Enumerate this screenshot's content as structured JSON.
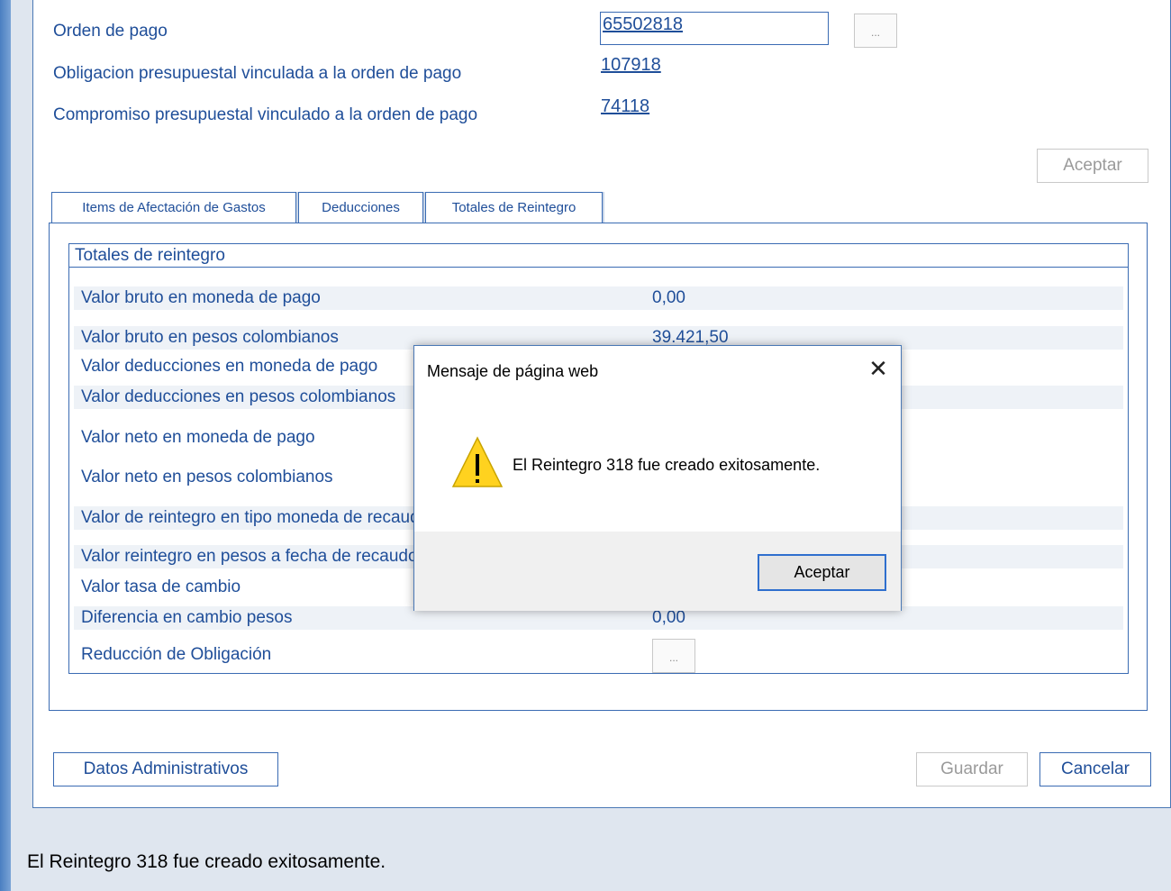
{
  "header": {
    "orden_label": "Orden de pago",
    "orden_value": "65502818",
    "obligacion_label": "Obligacion presupuestal vinculada a la orden de pago",
    "obligacion_value": "107918",
    "compromiso_label": "Compromiso presupuestal vinculado a la orden de pago",
    "compromiso_value": "74118",
    "ellipsis": "...",
    "aceptar": "Aceptar"
  },
  "tabs": [
    {
      "label": "Items de Afectación de Gastos"
    },
    {
      "label": "Deducciones"
    },
    {
      "label": "Totales de Reintegro"
    }
  ],
  "totales": {
    "title": "Totales de reintegro",
    "rows": [
      {
        "label": "Valor bruto en moneda de pago",
        "value": "0,00"
      },
      {
        "label": "Valor bruto en pesos colombianos",
        "value": "39.421,50"
      },
      {
        "label": "Valor deducciones en moneda de pago",
        "value": ""
      },
      {
        "label": "Valor deducciones en pesos colombianos",
        "value": ""
      },
      {
        "label": "Valor neto en moneda de pago",
        "value": ""
      },
      {
        "label": "Valor neto en pesos colombianos",
        "value": ""
      },
      {
        "label": "Valor de reintegro en tipo moneda de recaudo",
        "value": ""
      },
      {
        "label": "Valor reintegro en pesos a fecha de recaudo",
        "value": ""
      },
      {
        "label": "Valor tasa de cambio",
        "value": ""
      },
      {
        "label": "Diferencia en cambio pesos",
        "value": "0,00"
      },
      {
        "label": "Reducción de Obligación",
        "value": ""
      }
    ],
    "reduccion_button": "..."
  },
  "footer": {
    "datos_admin": "Datos Administrativos",
    "guardar": "Guardar",
    "cancelar": "Cancelar"
  },
  "status_message": "El Reintegro 318 fue creado exitosamente.",
  "dialog": {
    "title": "Mensaje de página web",
    "message": "El Reintegro 318 fue creado exitosamente.",
    "ok": "Aceptar",
    "icon": "warning-icon"
  }
}
